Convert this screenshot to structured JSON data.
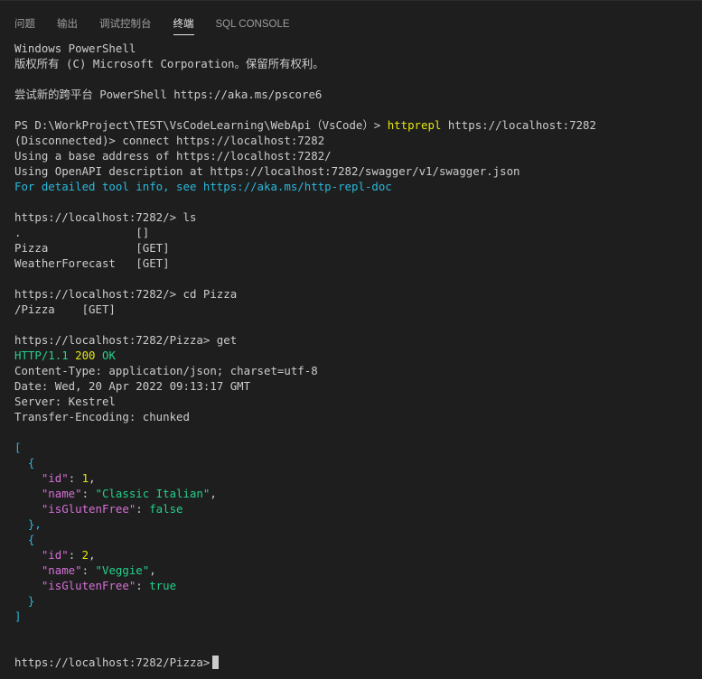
{
  "panel": {
    "tabs": [
      {
        "label": "问题"
      },
      {
        "label": "输出"
      },
      {
        "label": "调试控制台"
      },
      {
        "label": "终端"
      },
      {
        "label": "SQL CONSOLE"
      }
    ],
    "active_tab": "终端"
  },
  "terminal": {
    "lines": [
      {
        "segments": [
          {
            "t": "Windows PowerShell"
          }
        ]
      },
      {
        "segments": [
          {
            "t": "版权所有 (C) Microsoft Corporation。保留所有权利。"
          }
        ]
      },
      {
        "segments": [
          {
            "t": ""
          }
        ]
      },
      {
        "segments": [
          {
            "t": "尝试新的跨平台 PowerShell https://aka.ms/pscore6"
          }
        ]
      },
      {
        "segments": [
          {
            "t": ""
          }
        ]
      },
      {
        "segments": [
          {
            "t": "PS D:\\WorkProject\\TEST\\VsCodeLearning\\WebApi（VsCode）> "
          },
          {
            "t": "httprepl",
            "c": "yellow"
          },
          {
            "t": " https://localhost:7282"
          }
        ]
      },
      {
        "segments": [
          {
            "t": "(Disconnected)> connect https://localhost:7282"
          }
        ]
      },
      {
        "segments": [
          {
            "t": "Using a base address of https://localhost:7282/"
          }
        ]
      },
      {
        "segments": [
          {
            "t": "Using OpenAPI description at https://localhost:7282/swagger/v1/swagger.json"
          }
        ]
      },
      {
        "segments": [
          {
            "t": "For detailed tool info, see https://aka.ms/http-repl-doc",
            "c": "cyan"
          }
        ]
      },
      {
        "segments": [
          {
            "t": ""
          }
        ]
      },
      {
        "segments": [
          {
            "t": "https://localhost:7282/> ls"
          }
        ]
      },
      {
        "segments": [
          {
            "t": ".                 []"
          }
        ]
      },
      {
        "segments": [
          {
            "t": "Pizza             [GET]"
          }
        ]
      },
      {
        "segments": [
          {
            "t": "WeatherForecast   [GET]"
          }
        ]
      },
      {
        "segments": [
          {
            "t": ""
          }
        ]
      },
      {
        "segments": [
          {
            "t": "https://localhost:7282/> cd Pizza"
          }
        ]
      },
      {
        "segments": [
          {
            "t": "/Pizza    [GET]"
          }
        ]
      },
      {
        "segments": [
          {
            "t": ""
          }
        ]
      },
      {
        "segments": [
          {
            "t": "https://localhost:7282/Pizza> get"
          }
        ]
      },
      {
        "segments": [
          {
            "t": "HTTP/1.1 ",
            "c": "green"
          },
          {
            "t": "200",
            "c": "yellow"
          },
          {
            "t": " OK",
            "c": "green"
          }
        ]
      },
      {
        "segments": [
          {
            "t": "Content-Type: application/json; charset=utf-8"
          }
        ]
      },
      {
        "segments": [
          {
            "t": "Date: Wed, 20 Apr 2022 09:13:17 GMT"
          }
        ]
      },
      {
        "segments": [
          {
            "t": "Server: Kestrel"
          }
        ]
      },
      {
        "segments": [
          {
            "t": "Transfer-Encoding: chunked"
          }
        ]
      },
      {
        "segments": [
          {
            "t": ""
          }
        ]
      },
      {
        "segments": [
          {
            "t": "[",
            "c": "cyan"
          }
        ]
      },
      {
        "segments": [
          {
            "t": "  {",
            "c": "cyan"
          }
        ]
      },
      {
        "segments": [
          {
            "t": "    "
          },
          {
            "t": "\"id\"",
            "c": "magenta"
          },
          {
            "t": ": "
          },
          {
            "t": "1",
            "c": "yellow"
          },
          {
            "t": ","
          }
        ]
      },
      {
        "segments": [
          {
            "t": "    "
          },
          {
            "t": "\"name\"",
            "c": "magenta"
          },
          {
            "t": ": "
          },
          {
            "t": "\"Classic Italian\"",
            "c": "green"
          },
          {
            "t": ","
          }
        ]
      },
      {
        "segments": [
          {
            "t": "    "
          },
          {
            "t": "\"isGlutenFree\"",
            "c": "magenta"
          },
          {
            "t": ": "
          },
          {
            "t": "false",
            "c": "green"
          }
        ]
      },
      {
        "segments": [
          {
            "t": "  },",
            "c": "cyan"
          }
        ]
      },
      {
        "segments": [
          {
            "t": "  {",
            "c": "cyan"
          }
        ]
      },
      {
        "segments": [
          {
            "t": "    "
          },
          {
            "t": "\"id\"",
            "c": "magenta"
          },
          {
            "t": ": "
          },
          {
            "t": "2",
            "c": "yellow"
          },
          {
            "t": ","
          }
        ]
      },
      {
        "segments": [
          {
            "t": "    "
          },
          {
            "t": "\"name\"",
            "c": "magenta"
          },
          {
            "t": ": "
          },
          {
            "t": "\"Veggie\"",
            "c": "green"
          },
          {
            "t": ","
          }
        ]
      },
      {
        "segments": [
          {
            "t": "    "
          },
          {
            "t": "\"isGlutenFree\"",
            "c": "magenta"
          },
          {
            "t": ": "
          },
          {
            "t": "true",
            "c": "green"
          }
        ]
      },
      {
        "segments": [
          {
            "t": "  }",
            "c": "cyan"
          }
        ]
      },
      {
        "segments": [
          {
            "t": "]",
            "c": "cyan"
          }
        ]
      },
      {
        "segments": [
          {
            "t": ""
          }
        ]
      },
      {
        "segments": [
          {
            "t": ""
          }
        ]
      },
      {
        "segments": [
          {
            "t": "https://localhost:7282/Pizza>"
          }
        ],
        "cursor": true
      }
    ]
  },
  "colors": {
    "background": "#1e1e1e",
    "foreground": "#cccccc",
    "yellow": "#e5e510",
    "cyan": "#29b8db",
    "green": "#23d18b",
    "magenta": "#d670d6"
  }
}
